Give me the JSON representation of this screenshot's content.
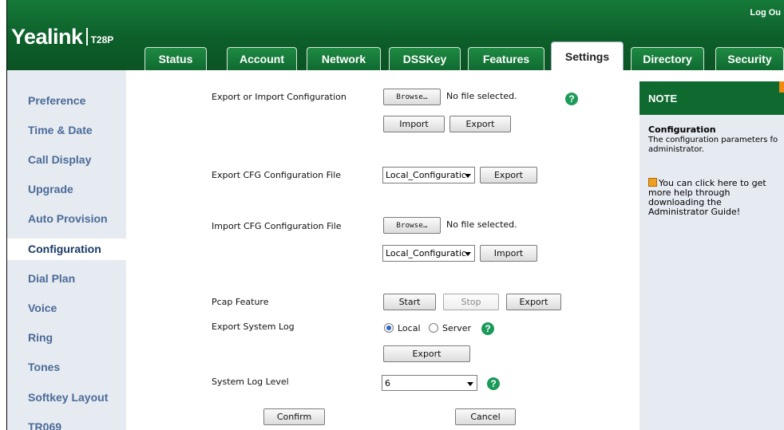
{
  "header": {
    "logo": "Yealink",
    "model": "T28P",
    "logout_label": "Log Ou"
  },
  "tabs": [
    {
      "label": "Status",
      "active": false
    },
    {
      "label": "Account",
      "active": false
    },
    {
      "label": "Network",
      "active": false
    },
    {
      "label": "DSSKey",
      "active": false
    },
    {
      "label": "Features",
      "active": false
    },
    {
      "label": "Settings",
      "active": true
    },
    {
      "label": "Directory",
      "active": false
    },
    {
      "label": "Security",
      "active": false
    }
  ],
  "sidebar": {
    "items": [
      {
        "label": "Preference"
      },
      {
        "label": "Time & Date"
      },
      {
        "label": "Call Display"
      },
      {
        "label": "Upgrade"
      },
      {
        "label": "Auto Provision"
      },
      {
        "label": "Configuration",
        "active": true
      },
      {
        "label": "Dial Plan"
      },
      {
        "label": "Voice"
      },
      {
        "label": "Ring"
      },
      {
        "label": "Tones"
      },
      {
        "label": "Softkey Layout"
      },
      {
        "label": "TR069"
      }
    ]
  },
  "form": {
    "export_import": {
      "label": "Export or Import Configuration",
      "browse_label": "Browse…",
      "file_status": "No file selected.",
      "import_label": "Import",
      "export_label": "Export"
    },
    "export_cfg": {
      "label": "Export CFG Configuration File",
      "select_value": "Local_Configuratic",
      "export_label": "Export"
    },
    "import_cfg": {
      "label": "Import CFG Configuration File",
      "browse_label": "Browse…",
      "file_status": "No file selected.",
      "select_value": "Local_Configuratic",
      "import_label": "Import"
    },
    "pcap": {
      "label": "Pcap Feature",
      "start_label": "Start",
      "stop_label": "Stop",
      "export_label": "Export"
    },
    "system_log": {
      "label": "Export System Log",
      "local_label": "Local",
      "server_label": "Server",
      "selected": "Local",
      "export_label": "Export"
    },
    "log_level": {
      "label": "System Log Level",
      "value": "6"
    },
    "confirm_label": "Confirm",
    "cancel_label": "Cancel",
    "help_icon": "?"
  },
  "note": {
    "title": "NOTE",
    "subtitle": "Configuration",
    "text_line1": "The configuration parameters fo",
    "text_line2": "administrator.",
    "guide_line1": "You can click here to get",
    "guide_line2": "more help through",
    "guide_line3": "downloading the",
    "guide_line4": "Administrator Guide!"
  },
  "colors": {
    "header_green": "#0f6a30",
    "sidebar_bg": "#e6eaf1",
    "sidebar_text": "#4a6b98",
    "help_green": "#1c9a5a",
    "note_tag_orange": "#f08a10"
  }
}
